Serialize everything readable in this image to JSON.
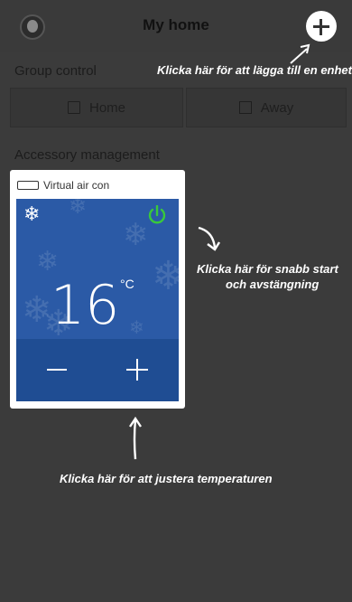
{
  "header": {
    "title": "My home"
  },
  "hints": {
    "add_device": "Klicka här för att lägga till en enhet",
    "power_line1": "Klicka här för snabb start",
    "power_line2": "och avstängning",
    "temperature": "Klicka här för att justera temperaturen"
  },
  "group_control": {
    "label": "Group control",
    "buttons": [
      {
        "label": "Home"
      },
      {
        "label": "Away"
      }
    ]
  },
  "accessory": {
    "label": "Accessory management",
    "device": {
      "name": "Virtual air con",
      "temperature": "16",
      "unit": "°C",
      "mode_icon": "snowflake-icon",
      "power_icon": "power-icon"
    }
  },
  "colors": {
    "panel": "#2b5aa6",
    "panel_controls": "#1f4d93",
    "power": "#39c93b",
    "overlay": "#3b3b3b"
  }
}
